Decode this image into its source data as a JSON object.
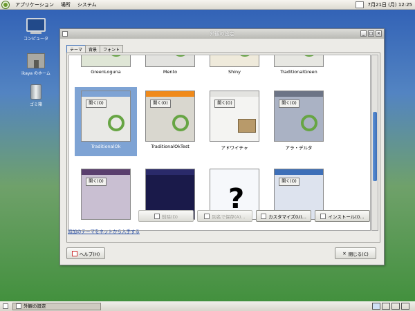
{
  "topbar": {
    "menus": [
      "アプリケーション",
      "場所",
      "システム"
    ],
    "datetime": "7月21日 (月) 12:25"
  },
  "desktop": {
    "icons": [
      {
        "label": "コンピュータ",
        "icon": "computer-icon"
      },
      {
        "label": "ikaya のホーム",
        "icon": "home-folder-icon"
      },
      {
        "label": "ゴミ箱",
        "icon": "trash-icon"
      }
    ]
  },
  "window": {
    "title": "外観の設定",
    "tabs": [
      "テーマ",
      "背景",
      "フォント"
    ],
    "themes": [
      {
        "name": "GreenLoguna"
      },
      {
        "name": "Mento"
      },
      {
        "name": "Shiny"
      },
      {
        "name": "TraditionalGreen"
      },
      {
        "name": "TraditionalOk",
        "selected": true
      },
      {
        "name": "TraditionalOkTest"
      },
      {
        "name": "アドワイチャ"
      },
      {
        "name": "アラ・デルタ"
      }
    ],
    "thumb_button": "開く(O)",
    "buttons": {
      "delete": "削除(D)",
      "save_as": "別名で保存(A)...",
      "customize": "カスタマイズ(U)...",
      "install": "インストール(I)..."
    },
    "link": "追加のテーマをネットから入手する",
    "help": "ヘルプ(H)",
    "close": "閉じる(C)"
  },
  "taskbar": {
    "item": "外観の設定"
  },
  "colors": {
    "accent": "#3d6fb8",
    "ring": "#67a544"
  }
}
